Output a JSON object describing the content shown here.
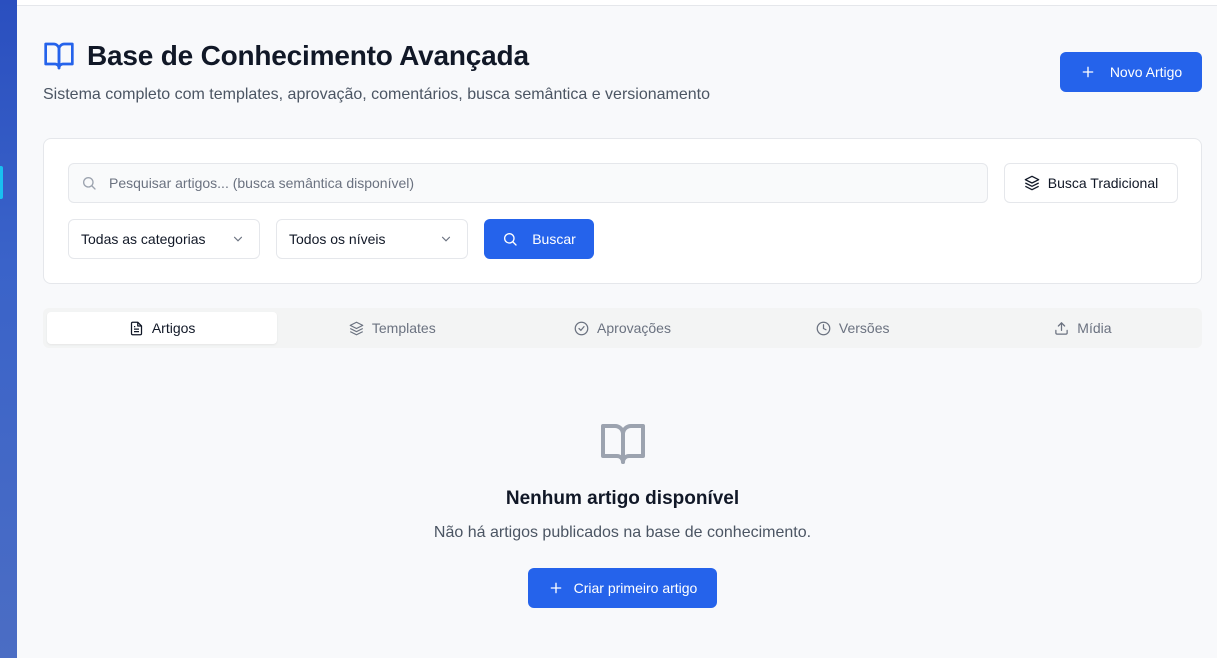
{
  "header": {
    "title": "Base de Conhecimento Avançada",
    "subtitle": "Sistema completo com templates, aprovação, comentários, busca semântica e versionamento",
    "new_button_label": "Novo Artigo"
  },
  "search": {
    "placeholder": "Pesquisar artigos... (busca semântica disponível)",
    "value": "",
    "mode_button_label": "Busca Tradicional",
    "category_select_value": "Todas as categorias",
    "level_select_value": "Todos os níveis",
    "search_button_label": "Buscar"
  },
  "tabs": [
    {
      "label": "Artigos",
      "icon": "file-text-icon",
      "active": true
    },
    {
      "label": "Templates",
      "icon": "layers-icon",
      "active": false
    },
    {
      "label": "Aprovações",
      "icon": "check-circle-icon",
      "active": false
    },
    {
      "label": "Versões",
      "icon": "clock-icon",
      "active": false
    },
    {
      "label": "Mídia",
      "icon": "upload-icon",
      "active": false
    }
  ],
  "empty_state": {
    "icon": "book-open-icon",
    "title": "Nenhum artigo disponível",
    "description": "Não há artigos publicados na base de conhecimento.",
    "button_label": "Criar primeiro artigo"
  },
  "colors": {
    "primary": "#2563eb",
    "sidebar": "#2a4fbf",
    "sidebar_active": "#19c0f0",
    "background": "#f8f9fb"
  }
}
